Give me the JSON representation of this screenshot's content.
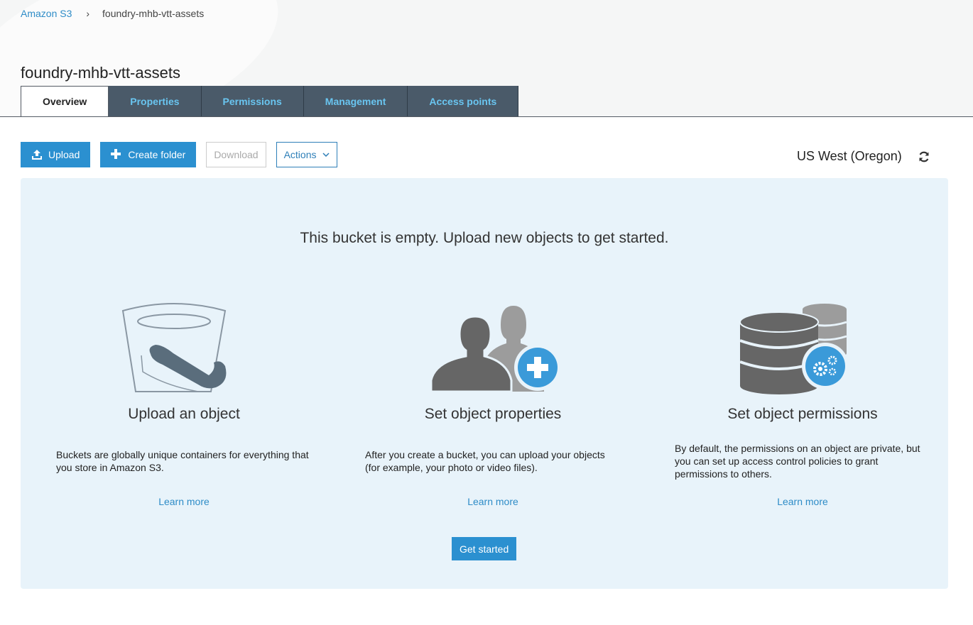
{
  "breadcrumb": {
    "root": "Amazon S3",
    "separator": "›",
    "current": "foundry-mhb-vtt-assets"
  },
  "page": {
    "title": "foundry-mhb-vtt-assets"
  },
  "tabs": [
    {
      "label": "Overview",
      "active": true
    },
    {
      "label": "Properties",
      "active": false
    },
    {
      "label": "Permissions",
      "active": false
    },
    {
      "label": "Management",
      "active": false
    },
    {
      "label": "Access points",
      "active": false
    }
  ],
  "toolbar": {
    "upload": "Upload",
    "create_folder": "Create folder",
    "download": "Download",
    "actions": "Actions"
  },
  "region": {
    "label": "US West (Oregon)"
  },
  "empty": {
    "heading": "This bucket is empty. Upload new objects to get started.",
    "features": [
      {
        "title": "Upload an object",
        "description": "Buckets are globally unique containers for everything that you store in Amazon S3.",
        "link": "Learn more",
        "icon": "bucket-icon"
      },
      {
        "title": "Set object properties",
        "description": "After you create a bucket, you can upload your objects (for example, your photo or video files).",
        "link": "Learn more",
        "icon": "users-add-icon"
      },
      {
        "title": "Set object permissions",
        "description": "By default, the permissions on an object are private, but you can set up access control policies to grant permissions to others.",
        "link": "Learn more",
        "icon": "database-settings-icon"
      }
    ],
    "cta": "Get started"
  },
  "colors": {
    "accent": "#2b90d0",
    "link": "#2e8cc7",
    "tab_bg": "#4a5a69",
    "tab_text": "#69c5f0",
    "panel_bg": "#e8f3fa",
    "icon_gray": "#6b6b6b"
  }
}
